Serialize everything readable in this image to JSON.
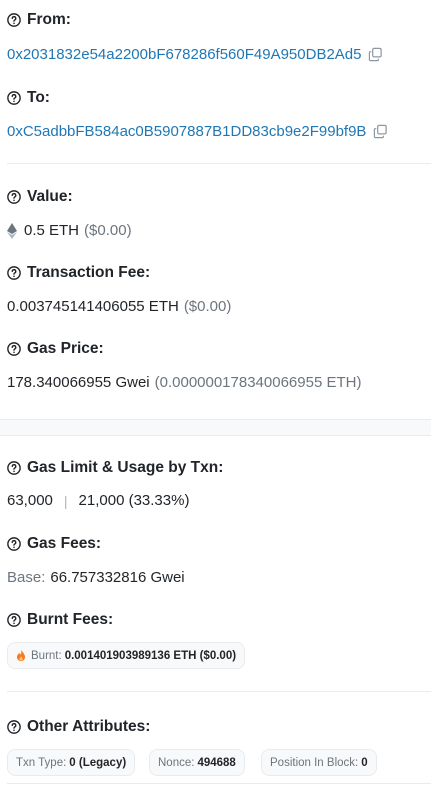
{
  "from": {
    "label": "From:",
    "address": "0x2031832e54a2200bF678286f560F49A950DB2Ad5"
  },
  "to": {
    "label": "To:",
    "address": "0xC5adbbFB584ac0B5907887B1DD83cb9e2F99bf9B"
  },
  "value": {
    "label": "Value:",
    "amount": "0.5 ETH",
    "usd": "($0.00)"
  },
  "fee": {
    "label": "Transaction Fee:",
    "amount": "0.003745141406055 ETH",
    "usd": "($0.00)"
  },
  "gas_price": {
    "label": "Gas Price:",
    "amount": "178.340066955 Gwei",
    "eth": "(0.000000178340066955 ETH)"
  },
  "gas_limit": {
    "label": "Gas Limit & Usage by Txn:",
    "limit": "63,000",
    "separator": "|",
    "usage": "21,000 (33.33%)"
  },
  "gas_fees": {
    "label": "Gas Fees:",
    "base_key": "Base:",
    "base_value": "66.757332816 Gwei"
  },
  "burnt": {
    "label": "Burnt Fees:",
    "key": "Burnt:",
    "value": "0.001401903989136 ETH ($0.00)"
  },
  "other": {
    "label": "Other Attributes:",
    "txn_type_key": "Txn Type:",
    "txn_type_value": "0 (Legacy)",
    "nonce_key": "Nonce:",
    "nonce_value": "494688",
    "position_key": "Position In Block:",
    "position_value": "0"
  },
  "colors": {
    "link": "#1f77b4",
    "muted": "#6c757d",
    "flame": "#f47c20"
  }
}
